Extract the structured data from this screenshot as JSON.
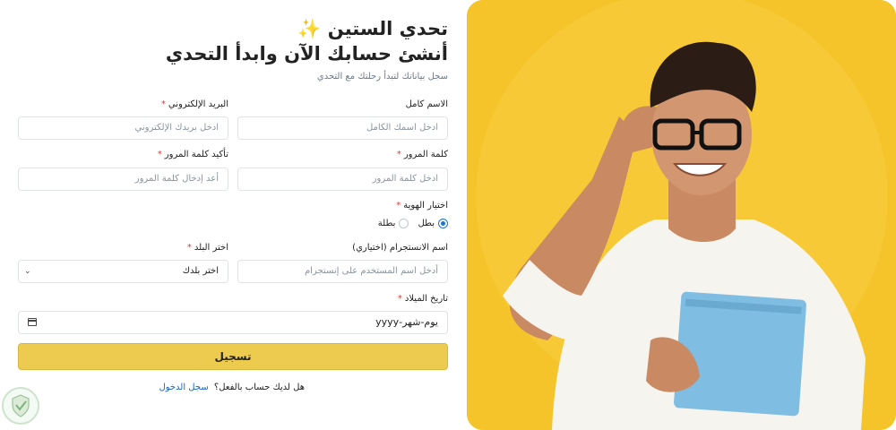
{
  "header": {
    "title_line1": "تحدي الستين",
    "sparkle": "✨",
    "title_line2": "أنشئ حسابك الآن وابدأ التحدي",
    "subtitle": "سجل بياناتك لتبدأ رحلتك مع التحدي"
  },
  "form": {
    "full_name": {
      "label": "الاسم كامل",
      "required": "*",
      "placeholder": "ادخل اسمك الكامل"
    },
    "email": {
      "label": "البريد الإلكتروني",
      "required": "*",
      "placeholder": "ادخل بريدك الإلكتروني"
    },
    "password": {
      "label": "كلمة المرور",
      "required": "*",
      "placeholder": "ادخل كلمة المرور"
    },
    "confirm_password": {
      "label": "تأكيد كلمة المرور",
      "required": "*",
      "placeholder": "أعد إدخال كلمة المرور"
    },
    "identity": {
      "label": "اختيار الهوية",
      "required": "*",
      "options": [
        "بطل",
        "بطلة"
      ],
      "selected": "بطل"
    },
    "instagram": {
      "label": "اسم الانستجرام (اختياري)",
      "placeholder": "أدخل اسم المستخدم على إنستجرام"
    },
    "country": {
      "label": "اختر البلد",
      "required": "*",
      "value": "اختر بلدك"
    },
    "birthdate": {
      "label": "تاريخ الميلاد",
      "required": "*",
      "value": "يوم-شهر-yyyy"
    },
    "submit_label": "تسجيل",
    "login_prompt": "هل لديك حساب بالفعل؟",
    "login_link": "سجل الدخول"
  },
  "hero": {
    "background_color": "#f5c42a",
    "accent_color": "#eccb4f",
    "link_color": "#1565c0"
  },
  "icons": {
    "sparkle": "sparkle-icon",
    "calendar": "calendar-icon",
    "chevron": "chevron-down-icon",
    "watermark": "shield-logo-icon"
  }
}
